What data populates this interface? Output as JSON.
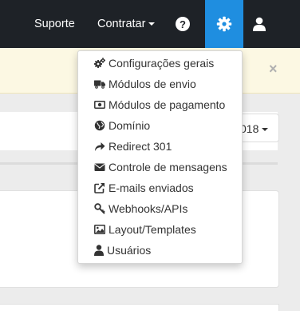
{
  "navbar": {
    "suporte_label": "Suporte",
    "contratar_label": "Contratar",
    "help_icon": "question-circle-icon",
    "settings_icon": "gear-icon",
    "user_icon": "user-icon",
    "active_color": "#1f8ee0",
    "background_color": "#1e2227"
  },
  "alert": {
    "close_label": "×",
    "background_color": "#fcf8e3"
  },
  "content": {
    "year_select_value": "018"
  },
  "menu": {
    "items": [
      {
        "label": "Configurações gerais",
        "icon": "cogs-icon"
      },
      {
        "label": "Módulos de envio",
        "icon": "truck-icon"
      },
      {
        "label": "Módulos de pagamento",
        "icon": "money-icon"
      },
      {
        "label": "Domínio",
        "icon": "globe-icon"
      },
      {
        "label": "Redirect 301",
        "icon": "share-icon"
      },
      {
        "label": "Controle de mensagens",
        "icon": "envelope-icon"
      },
      {
        "label": "E-mails enviados",
        "icon": "external-link-icon"
      },
      {
        "label": "Webhooks/APIs",
        "icon": "key-icon"
      },
      {
        "label": "Layout/Templates",
        "icon": "image-icon"
      },
      {
        "label": "Usuários",
        "icon": "user-icon"
      }
    ]
  }
}
